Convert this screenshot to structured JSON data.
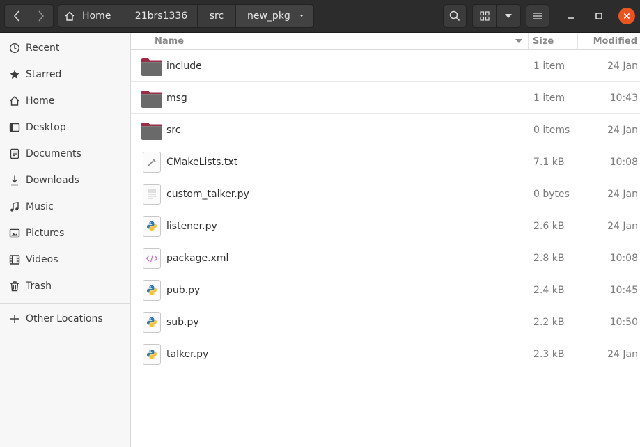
{
  "nav": {
    "back_icon": "chevron-left-icon",
    "forward_icon": "chevron-right-icon"
  },
  "path": {
    "home_label": "Home",
    "segments": [
      "21brs1336",
      "src",
      "new_pkg"
    ]
  },
  "toolbar": {
    "search_icon": "search-icon",
    "grid_view_icon": "grid-view-icon",
    "view_options_icon": "chevron-down-icon",
    "menu_icon": "hamburger-menu-icon"
  },
  "window": {
    "close_color": "#e95420"
  },
  "sidebar": {
    "items": [
      {
        "label": "Recent",
        "icon": "clock-icon"
      },
      {
        "label": "Starred",
        "icon": "star-icon"
      },
      {
        "label": "Home",
        "icon": "home-icon"
      },
      {
        "label": "Desktop",
        "icon": "desktop-icon"
      },
      {
        "label": "Documents",
        "icon": "documents-icon"
      },
      {
        "label": "Downloads",
        "icon": "download-icon"
      },
      {
        "label": "Music",
        "icon": "music-icon"
      },
      {
        "label": "Pictures",
        "icon": "pictures-icon"
      },
      {
        "label": "Videos",
        "icon": "videos-icon"
      },
      {
        "label": "Trash",
        "icon": "trash-icon"
      }
    ],
    "other_locations": "Other Locations"
  },
  "columns": {
    "name": "Name",
    "size": "Size",
    "modified": "Modified"
  },
  "files": [
    {
      "name": "include",
      "size": "1 item",
      "modified": "24 Jan",
      "type": "folder"
    },
    {
      "name": "msg",
      "size": "1 item",
      "modified": "10:43",
      "type": "folder"
    },
    {
      "name": "src",
      "size": "0 items",
      "modified": "24 Jan",
      "type": "folder"
    },
    {
      "name": "CMakeLists.txt",
      "size": "7.1 kB",
      "modified": "10:08",
      "type": "build"
    },
    {
      "name": "custom_talker.py",
      "size": "0 bytes",
      "modified": "24 Jan",
      "type": "text"
    },
    {
      "name": "listener.py",
      "size": "2.6 kB",
      "modified": "24 Jan",
      "type": "python"
    },
    {
      "name": "package.xml",
      "size": "2.8 kB",
      "modified": "10:08",
      "type": "xml"
    },
    {
      "name": "pub.py",
      "size": "2.4 kB",
      "modified": "10:45",
      "type": "python"
    },
    {
      "name": "sub.py",
      "size": "2.2 kB",
      "modified": "10:50",
      "type": "python"
    },
    {
      "name": "talker.py",
      "size": "2.3 kB",
      "modified": "24 Jan",
      "type": "python"
    }
  ]
}
